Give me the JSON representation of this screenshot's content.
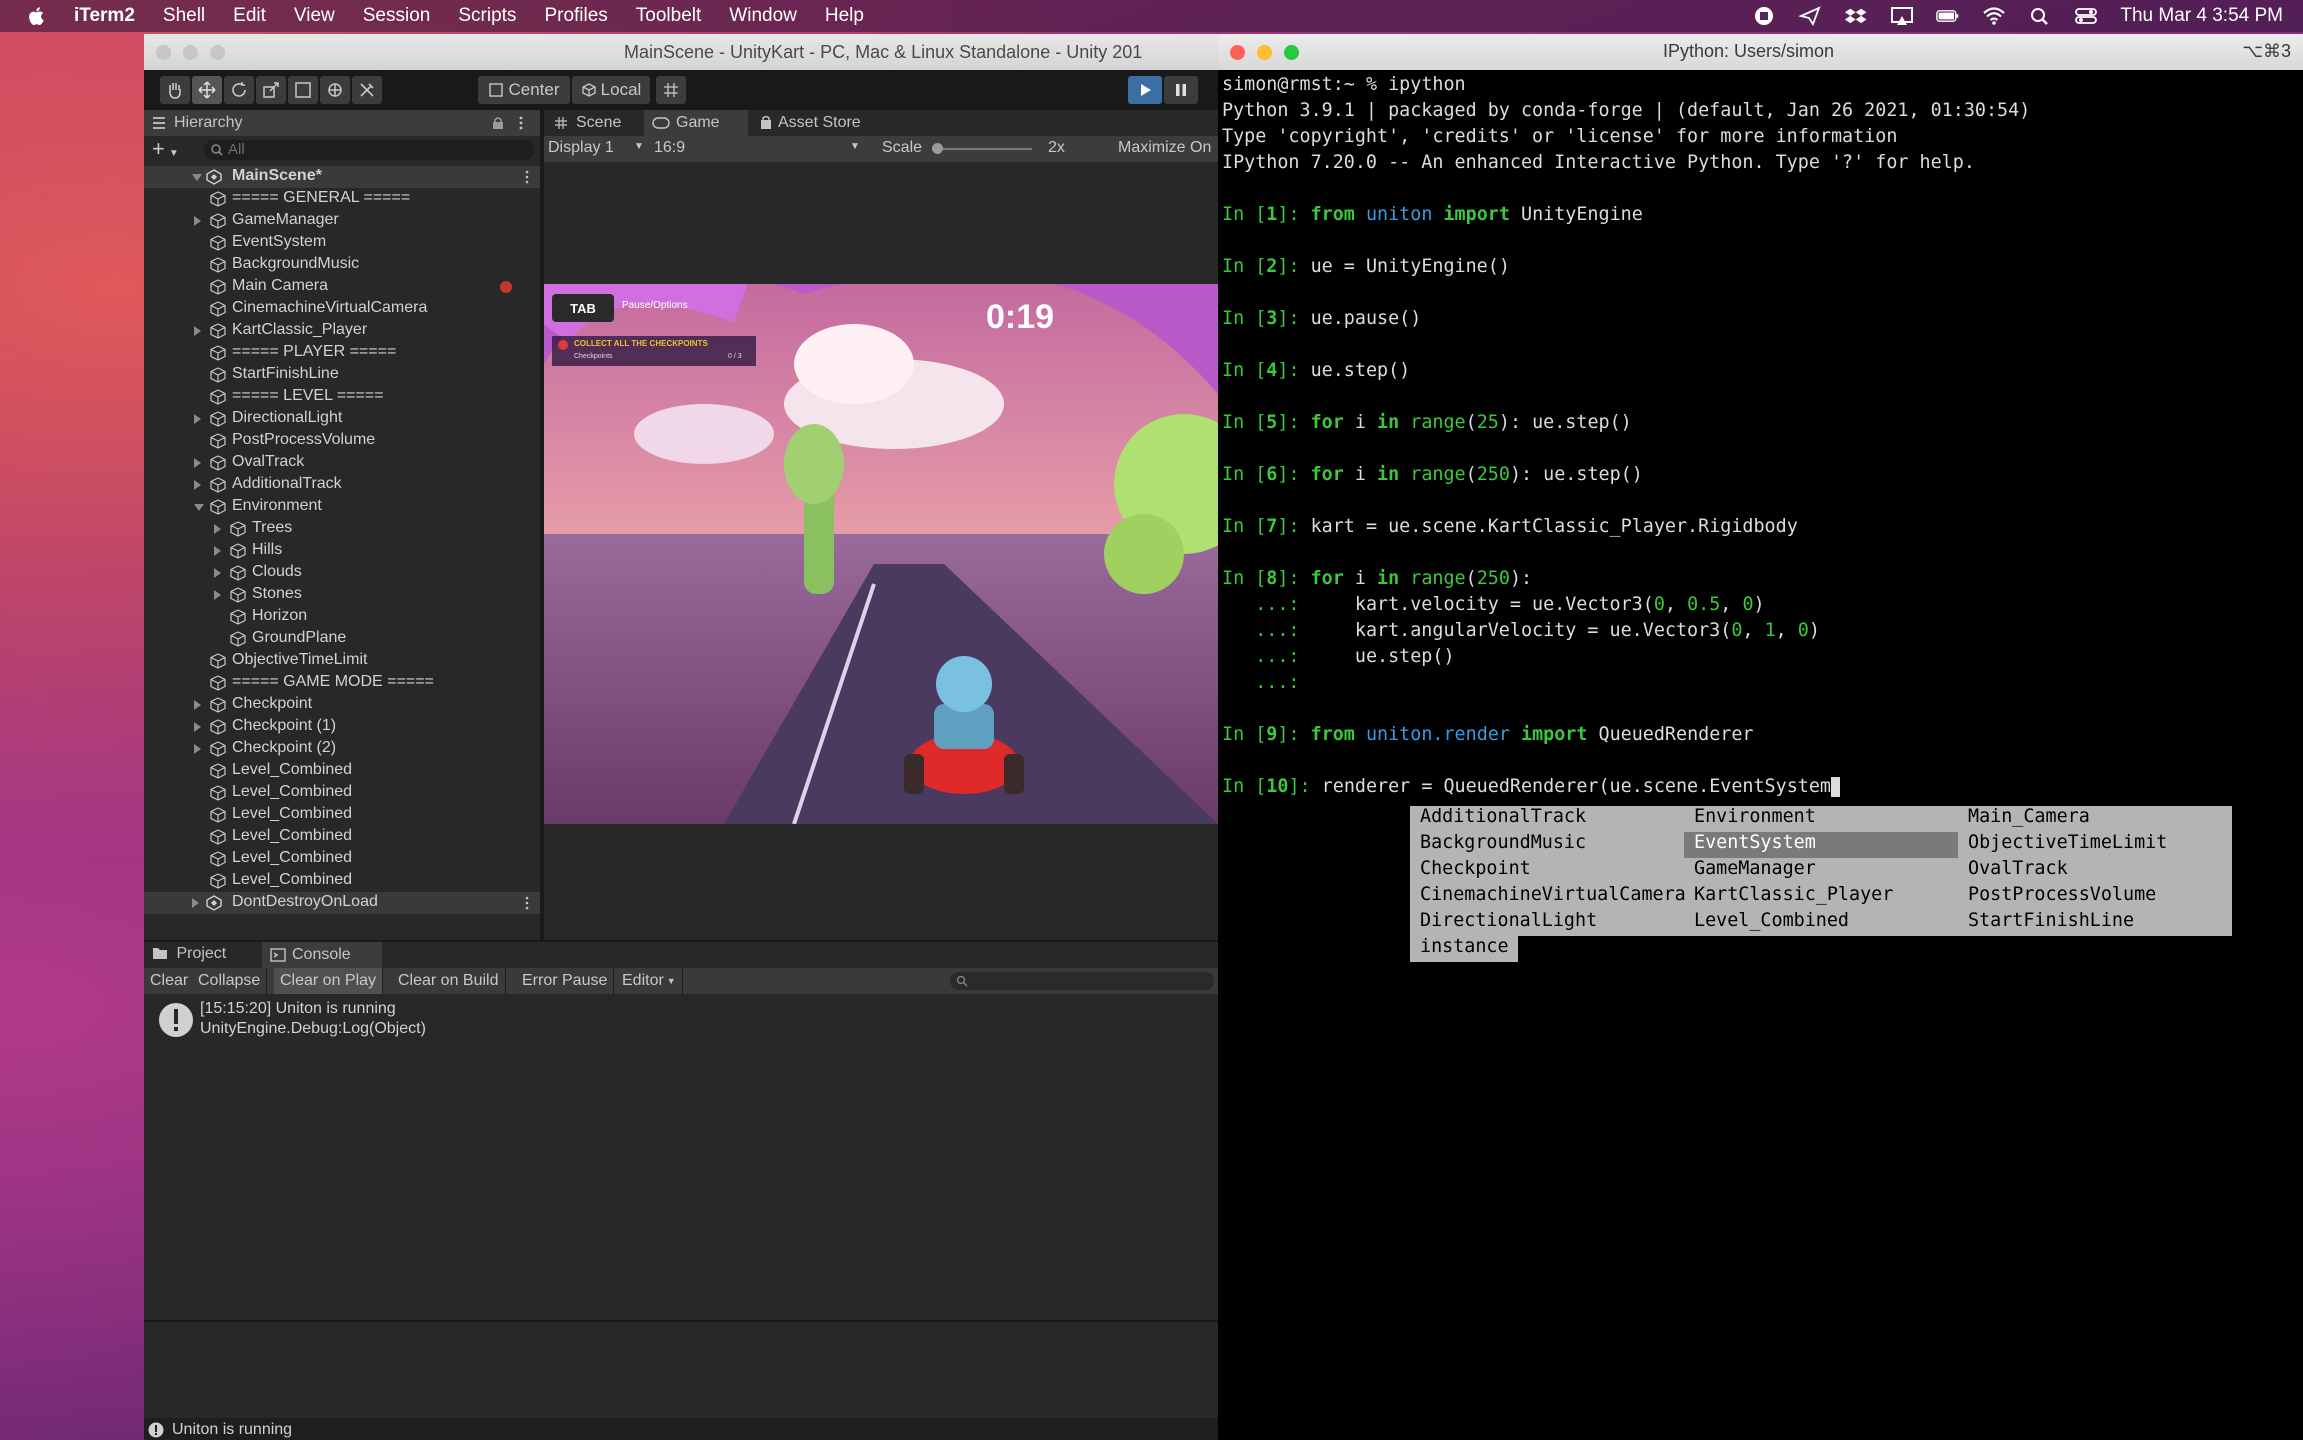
{
  "menubar": {
    "app": "iTerm2",
    "items": [
      "Shell",
      "Edit",
      "View",
      "Session",
      "Scripts",
      "Profiles",
      "Toolbelt",
      "Window",
      "Help"
    ],
    "clock": "Thu Mar 4  3:54 PM"
  },
  "unity": {
    "window_title": "MainScene - UnityKart - PC, Mac & Linux Standalone - Unity 201",
    "toolbar": {
      "center": "Center",
      "local": "Local"
    },
    "hierarchy": {
      "tab": "Hierarchy",
      "search_placeholder": "All",
      "scene": "MainScene*",
      "dont_destroy": "DontDestroyOnLoad",
      "items": [
        {
          "label": "===== GENERAL =====",
          "arrow": "",
          "indent": 0
        },
        {
          "label": "GameManager",
          "arrow": "closed",
          "indent": 0
        },
        {
          "label": "EventSystem",
          "arrow": "",
          "indent": 0
        },
        {
          "label": "BackgroundMusic",
          "arrow": "",
          "indent": 0
        },
        {
          "label": "Main Camera",
          "arrow": "",
          "indent": 0
        },
        {
          "label": "CinemachineVirtualCamera",
          "arrow": "",
          "indent": 0
        },
        {
          "label": "KartClassic_Player",
          "arrow": "closed",
          "indent": 0
        },
        {
          "label": "===== PLAYER =====",
          "arrow": "",
          "indent": 0
        },
        {
          "label": "StartFinishLine",
          "arrow": "",
          "indent": 0
        },
        {
          "label": "===== LEVEL =====",
          "arrow": "",
          "indent": 0
        },
        {
          "label": "DirectionalLight",
          "arrow": "closed",
          "indent": 0
        },
        {
          "label": "PostProcessVolume",
          "arrow": "",
          "indent": 0
        },
        {
          "label": "OvalTrack",
          "arrow": "closed",
          "indent": 0
        },
        {
          "label": "AdditionalTrack",
          "arrow": "closed",
          "indent": 0
        },
        {
          "label": "Environment",
          "arrow": "open",
          "indent": 0
        },
        {
          "label": "Trees",
          "arrow": "closed",
          "indent": 1
        },
        {
          "label": "Hills",
          "arrow": "closed",
          "indent": 1
        },
        {
          "label": "Clouds",
          "arrow": "closed",
          "indent": 1
        },
        {
          "label": "Stones",
          "arrow": "closed",
          "indent": 1
        },
        {
          "label": "Horizon",
          "arrow": "",
          "indent": 1
        },
        {
          "label": "GroundPlane",
          "arrow": "",
          "indent": 1
        },
        {
          "label": "ObjectiveTimeLimit",
          "arrow": "",
          "indent": 0
        },
        {
          "label": "===== GAME MODE =====",
          "arrow": "",
          "indent": 0
        },
        {
          "label": "Checkpoint",
          "arrow": "closed",
          "indent": 0
        },
        {
          "label": "Checkpoint (1)",
          "arrow": "closed",
          "indent": 0
        },
        {
          "label": "Checkpoint (2)",
          "arrow": "closed",
          "indent": 0
        },
        {
          "label": "Level_Combined",
          "arrow": "",
          "indent": 0
        },
        {
          "label": "Level_Combined",
          "arrow": "",
          "indent": 0
        },
        {
          "label": "Level_Combined",
          "arrow": "",
          "indent": 0
        },
        {
          "label": "Level_Combined",
          "arrow": "",
          "indent": 0
        },
        {
          "label": "Level_Combined",
          "arrow": "",
          "indent": 0
        },
        {
          "label": "Level_Combined",
          "arrow": "",
          "indent": 0
        }
      ]
    },
    "tabs": {
      "scene": "Scene",
      "game": "Game",
      "asset_store": "Asset Store"
    },
    "game_toolbar": {
      "display": "Display 1",
      "aspect": "16:9",
      "scale_label": "Scale",
      "scale_value": "2x",
      "maximize": "Maximize On"
    },
    "game_hud": {
      "tab_key": "TAB",
      "pause": "Pause/Options",
      "timer": "0:19",
      "objective": "COLLECT ALL THE CHECKPOINTS",
      "objective_sub": "Checkpoints",
      "objective_count": "0 / 3"
    },
    "bottom": {
      "project_tab": "Project",
      "console_tab": "Console",
      "buttons": [
        "Clear",
        "Collapse",
        "Clear on Play",
        "Clear on Build",
        "Error Pause",
        "Editor"
      ],
      "log_line1": "[15:15:20] Uniton is running",
      "log_line2": "UnityEngine.Debug:Log(Object)",
      "status": "Uniton is running"
    }
  },
  "terminal": {
    "title": "IPython: Users/simon",
    "shortcut": "⌥⌘3",
    "prompt_user": "simon@rmst",
    "prompt_path": ":~ % ",
    "command": "ipython",
    "banner": [
      "Python 3.9.1 | packaged by conda-forge | (default, Jan 26 2021, 01:30:54)",
      "Type 'copyright', 'credits' or 'license' for more information",
      "IPython 7.20.0 -- An enhanced Interactive Python. Type '?' for help."
    ],
    "autocomplete": {
      "columns": [
        [
          "AdditionalTrack",
          "BackgroundMusic",
          "Checkpoint",
          "CinemachineVirtualCamera",
          "DirectionalLight"
        ],
        [
          "Environment",
          "EventSystem",
          "GameManager",
          "KartClassic_Player",
          "Level_Combined"
        ],
        [
          "Main_Camera",
          "ObjectiveTimeLimit",
          "OvalTrack",
          "PostProcessVolume",
          "StartFinishLine"
        ]
      ],
      "selected": "EventSystem",
      "extra": "instance"
    }
  }
}
